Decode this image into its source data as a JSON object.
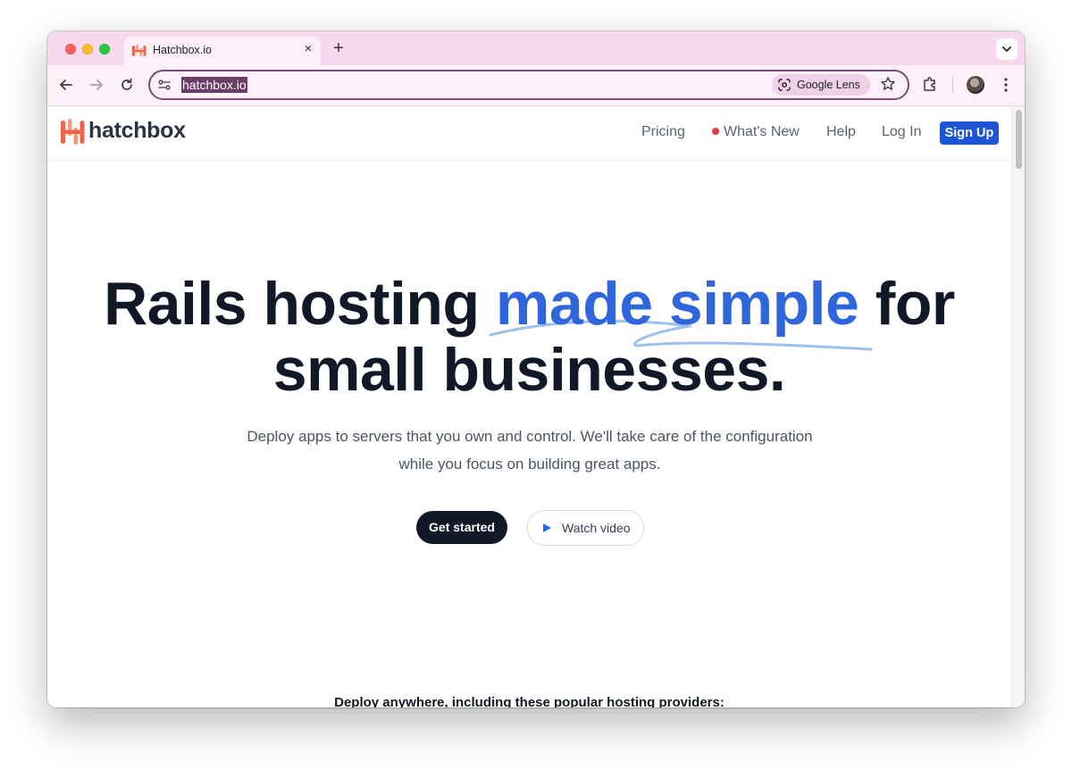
{
  "browser": {
    "tab": {
      "title": "Hatchbox.io",
      "close": "×"
    },
    "new_tab": "+",
    "url": "hatchbox.io",
    "lens_label": "Google Lens",
    "icons": [
      "back-icon",
      "forward-icon",
      "reload-icon",
      "site-info-icon",
      "google-lens-icon",
      "bookmark-star-icon",
      "extensions-icon",
      "profile-avatar",
      "more-menu-icon",
      "tab-search-icon"
    ],
    "traffic_colors": {
      "close": "#ff5f57",
      "minimize": "#febc2e",
      "zoom": "#28c840"
    },
    "theme": {
      "tabstrip": "#f6d9ee",
      "toolbar": "#fdf0f9",
      "url_highlight": "#6c3d65"
    }
  },
  "site": {
    "brand": "hatchbox",
    "nav": {
      "pricing": "Pricing",
      "whats_new": "What's New",
      "help": "Help",
      "login": "Log In",
      "signup": "Sign Up"
    },
    "hero": {
      "title_part1": "Rails hosting ",
      "title_accent": "made simple",
      "title_part2": " for",
      "title_line2": "small businesses.",
      "subtitle": "Deploy apps to servers that you own and control. We'll take care of the configuration while you focus on building great apps.",
      "cta_primary": "Get started",
      "cta_secondary": "Watch video"
    },
    "providers_heading": "Deploy anywhere, including these popular hosting providers:",
    "colors": {
      "accent": "#2f66db",
      "signup": "#1e54d6",
      "dark": "#111827",
      "brand_gradient": [
        "#f0624a",
        "#f59a7e"
      ],
      "new_dot": "#e23b3b"
    }
  }
}
